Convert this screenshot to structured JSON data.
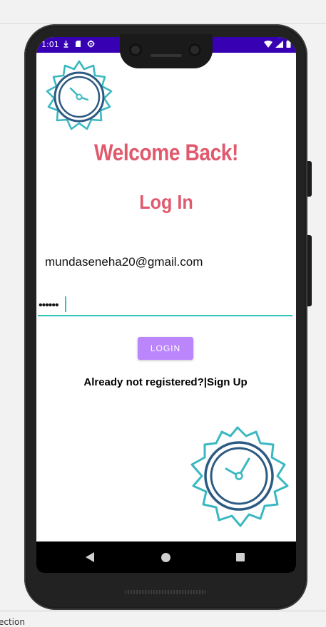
{
  "status_bar": {
    "time": "1:01",
    "bg_color": "#3700b3",
    "left_icons": [
      "download-arrow-icon",
      "sd-card-icon",
      "settings-gear-icon"
    ],
    "right_icons": [
      "wifi-icon",
      "signal-icon",
      "battery-icon"
    ]
  },
  "screen": {
    "welcome_text": "Welcome Back!",
    "heading": "Log In",
    "email_value": "mundaseneha20@gmail.com",
    "password_value": "••••••",
    "login_button_label": "LOGIN",
    "signup_prompt": "Already not registered?|",
    "signup_link": "Sign Up",
    "accent_color": "#e05a6e",
    "button_color": "#bb86fc",
    "underline_color": "#2ec4b6"
  },
  "navigation": {
    "icons": [
      "back-icon",
      "home-icon",
      "recents-icon"
    ]
  },
  "editor": {
    "bottom_label": "ection"
  }
}
